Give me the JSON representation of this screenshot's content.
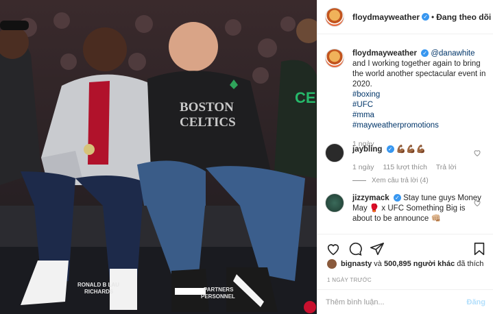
{
  "post": {
    "username": "floydmayweather",
    "verified_icon": "verified-badge-icon",
    "dot": "•",
    "follow_label": "Đang theo dõi"
  },
  "caption": {
    "username": "floydmayweather",
    "mention": "@danawhite",
    "text_after_mention": " and I working together again to bring the world another spectacular event in 2020.",
    "hashtags": [
      "#boxing",
      "#UFC",
      "#mma",
      "#mayweatherpromotions"
    ],
    "time": "1 ngày"
  },
  "comments": [
    {
      "username": "jaybling",
      "text": "💪🏾💪🏾💪🏾",
      "time": "1 ngày",
      "likes": "115 lượt thích",
      "reply_label": "Trả lời",
      "view_replies": "Xem câu trả lời (4)"
    },
    {
      "username": "jizzymack",
      "text": "Stay tune guys Money May 🥊 x UFC Something Big is about to be announce 👊🏼"
    }
  ],
  "likes": {
    "first_user": "bignasty",
    "connector": " và ",
    "count_text": "500,895 người khác",
    "suffix": " đã thích"
  },
  "date_text": "1 NGÀY TRƯỚC",
  "add_comment": {
    "placeholder": "Thêm bình luận...",
    "post_label": "Đăng"
  },
  "photo": {
    "jersey_text_1": "BOSTON",
    "jersey_text_2": "CELTICS",
    "sign_text_1": "RONALD B LAU",
    "sign_text_2": "RICHARDS",
    "sign_text_3": "PARTNERS",
    "sign_text_4": "PERSONNEL",
    "left_shirt_text": "CE"
  },
  "colors": {
    "accent_blue": "#3897f0",
    "mention_blue": "#003569",
    "muted": "#8e8e8e"
  }
}
